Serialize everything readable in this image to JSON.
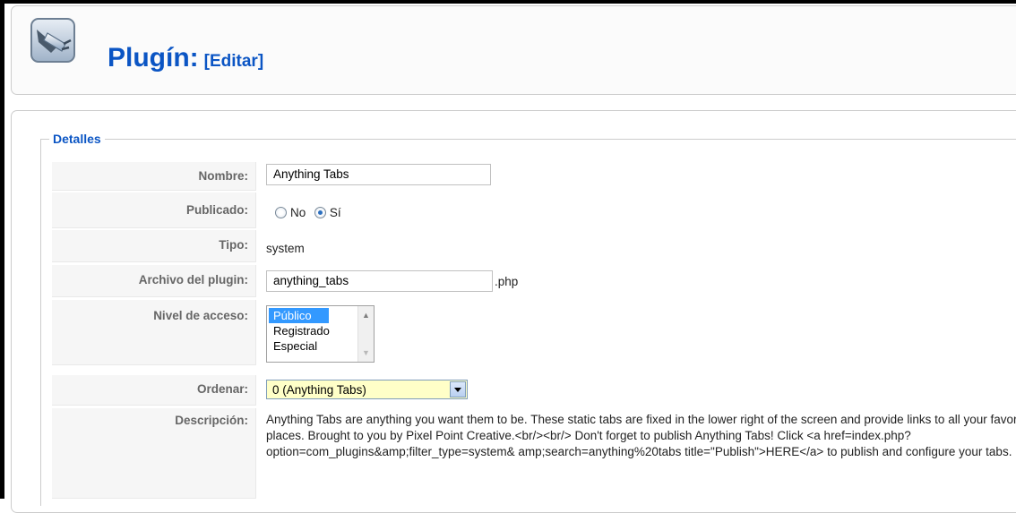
{
  "header": {
    "title": "Plugín:",
    "subtitle": "[Editar]",
    "icon": "plugin-plug-icon"
  },
  "details": {
    "legend": "Detalles",
    "nombre": {
      "label": "Nombre:",
      "value": "Anything Tabs"
    },
    "publicado": {
      "label": "Publicado:",
      "options": [
        "No",
        "Sí"
      ],
      "selected": "Sí"
    },
    "tipo": {
      "label": "Tipo:",
      "value": "system"
    },
    "archivo": {
      "label": "Archivo del plugin:",
      "value": "anything_tabs",
      "suffix": ".php"
    },
    "nivel": {
      "label": "Nivel de acceso:",
      "options": [
        "Público",
        "Registrado",
        "Especial"
      ],
      "selected": "Público"
    },
    "ordenar": {
      "label": "Ordenar:",
      "value": "0 (Anything Tabs)"
    },
    "descripcion": {
      "label": "Descripción:",
      "text": "Anything Tabs are anything you want them to be. These static tabs are fixed in the lower right of the screen and provide links to all your favorite places. Brought to you by Pixel Point Creative.<br/><br/> Don't forget to publish Anything Tabs! Click <a href=index.php?option=com_plugins&amp;filter_type=system& amp;search=anything%20tabs title=\"Publish\">HERE</a> to publish and configure your tabs."
    }
  },
  "colors": {
    "accent": "#0b55c4",
    "label": "#666666",
    "selection": "#3399ff",
    "select_bg": "#ffffc8"
  }
}
